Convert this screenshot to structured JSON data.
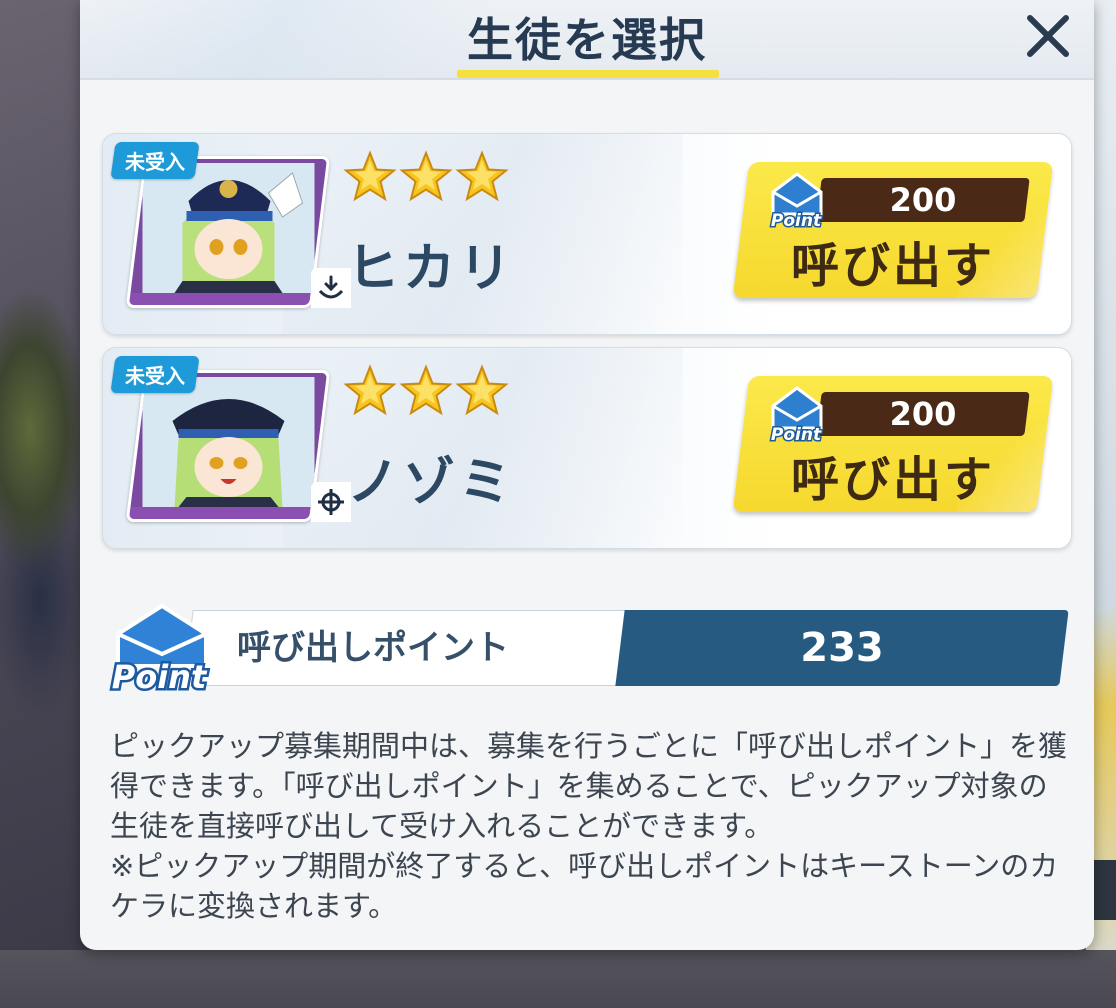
{
  "dialog": {
    "title": "生徒を選択",
    "close_icon": "close-icon"
  },
  "students": [
    {
      "badge": "未受入",
      "stars": 3,
      "name": "ヒカリ",
      "role_icon": "support-icon",
      "cost": "200",
      "call_label": "呼び出す"
    },
    {
      "badge": "未受入",
      "stars": 3,
      "name": "ノゾミ",
      "role_icon": "crosshair-icon",
      "cost": "200",
      "call_label": "呼び出す"
    }
  ],
  "points": {
    "label": "呼び出しポイント",
    "value": "233",
    "icon_text": "Point"
  },
  "description": {
    "line1": "ピックアップ募集期間中は、募集を行うごとに「呼び出しポイント」を獲得できます。「呼び出しポイント」を集めることで、ピックアップ対象の生徒を直接呼び出して受け入れることができます。",
    "line2": "※ピックアップ期間が終了すると、呼び出しポイントはキーストーンのカケラに変換されます。"
  },
  "colors": {
    "title": "#263a52",
    "accent_yellow": "#f6e040",
    "badge_blue": "#1e9ad8",
    "points_blue": "#265a80",
    "button_yellow": "#f6d82e"
  }
}
